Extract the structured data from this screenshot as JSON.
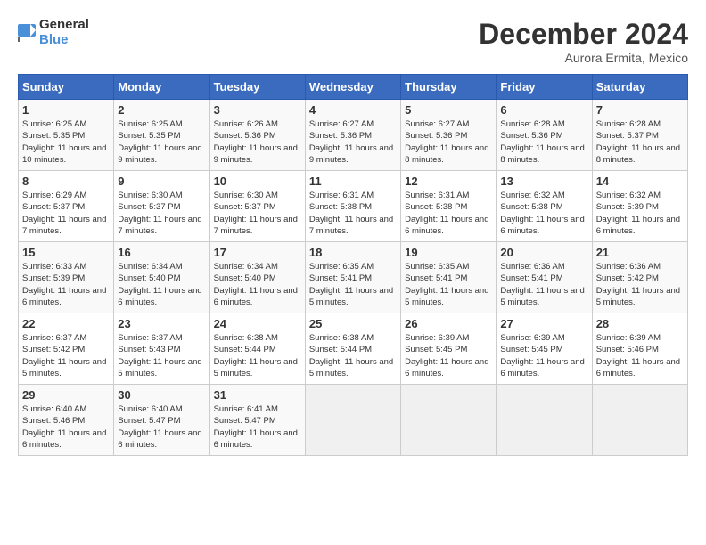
{
  "header": {
    "logo_line1": "General",
    "logo_line2": "Blue",
    "month": "December 2024",
    "location": "Aurora Ermita, Mexico"
  },
  "weekdays": [
    "Sunday",
    "Monday",
    "Tuesday",
    "Wednesday",
    "Thursday",
    "Friday",
    "Saturday"
  ],
  "weeks": [
    [
      {
        "day": "1",
        "sunrise": "6:25 AM",
        "sunset": "5:35 PM",
        "daylight": "11 hours and 10 minutes."
      },
      {
        "day": "2",
        "sunrise": "6:25 AM",
        "sunset": "5:35 PM",
        "daylight": "11 hours and 9 minutes."
      },
      {
        "day": "3",
        "sunrise": "6:26 AM",
        "sunset": "5:36 PM",
        "daylight": "11 hours and 9 minutes."
      },
      {
        "day": "4",
        "sunrise": "6:27 AM",
        "sunset": "5:36 PM",
        "daylight": "11 hours and 9 minutes."
      },
      {
        "day": "5",
        "sunrise": "6:27 AM",
        "sunset": "5:36 PM",
        "daylight": "11 hours and 8 minutes."
      },
      {
        "day": "6",
        "sunrise": "6:28 AM",
        "sunset": "5:36 PM",
        "daylight": "11 hours and 8 minutes."
      },
      {
        "day": "7",
        "sunrise": "6:28 AM",
        "sunset": "5:37 PM",
        "daylight": "11 hours and 8 minutes."
      }
    ],
    [
      {
        "day": "8",
        "sunrise": "6:29 AM",
        "sunset": "5:37 PM",
        "daylight": "11 hours and 7 minutes."
      },
      {
        "day": "9",
        "sunrise": "6:30 AM",
        "sunset": "5:37 PM",
        "daylight": "11 hours and 7 minutes."
      },
      {
        "day": "10",
        "sunrise": "6:30 AM",
        "sunset": "5:37 PM",
        "daylight": "11 hours and 7 minutes."
      },
      {
        "day": "11",
        "sunrise": "6:31 AM",
        "sunset": "5:38 PM",
        "daylight": "11 hours and 7 minutes."
      },
      {
        "day": "12",
        "sunrise": "6:31 AM",
        "sunset": "5:38 PM",
        "daylight": "11 hours and 6 minutes."
      },
      {
        "day": "13",
        "sunrise": "6:32 AM",
        "sunset": "5:38 PM",
        "daylight": "11 hours and 6 minutes."
      },
      {
        "day": "14",
        "sunrise": "6:32 AM",
        "sunset": "5:39 PM",
        "daylight": "11 hours and 6 minutes."
      }
    ],
    [
      {
        "day": "15",
        "sunrise": "6:33 AM",
        "sunset": "5:39 PM",
        "daylight": "11 hours and 6 minutes."
      },
      {
        "day": "16",
        "sunrise": "6:34 AM",
        "sunset": "5:40 PM",
        "daylight": "11 hours and 6 minutes."
      },
      {
        "day": "17",
        "sunrise": "6:34 AM",
        "sunset": "5:40 PM",
        "daylight": "11 hours and 6 minutes."
      },
      {
        "day": "18",
        "sunrise": "6:35 AM",
        "sunset": "5:41 PM",
        "daylight": "11 hours and 5 minutes."
      },
      {
        "day": "19",
        "sunrise": "6:35 AM",
        "sunset": "5:41 PM",
        "daylight": "11 hours and 5 minutes."
      },
      {
        "day": "20",
        "sunrise": "6:36 AM",
        "sunset": "5:41 PM",
        "daylight": "11 hours and 5 minutes."
      },
      {
        "day": "21",
        "sunrise": "6:36 AM",
        "sunset": "5:42 PM",
        "daylight": "11 hours and 5 minutes."
      }
    ],
    [
      {
        "day": "22",
        "sunrise": "6:37 AM",
        "sunset": "5:42 PM",
        "daylight": "11 hours and 5 minutes."
      },
      {
        "day": "23",
        "sunrise": "6:37 AM",
        "sunset": "5:43 PM",
        "daylight": "11 hours and 5 minutes."
      },
      {
        "day": "24",
        "sunrise": "6:38 AM",
        "sunset": "5:44 PM",
        "daylight": "11 hours and 5 minutes."
      },
      {
        "day": "25",
        "sunrise": "6:38 AM",
        "sunset": "5:44 PM",
        "daylight": "11 hours and 5 minutes."
      },
      {
        "day": "26",
        "sunrise": "6:39 AM",
        "sunset": "5:45 PM",
        "daylight": "11 hours and 6 minutes."
      },
      {
        "day": "27",
        "sunrise": "6:39 AM",
        "sunset": "5:45 PM",
        "daylight": "11 hours and 6 minutes."
      },
      {
        "day": "28",
        "sunrise": "6:39 AM",
        "sunset": "5:46 PM",
        "daylight": "11 hours and 6 minutes."
      }
    ],
    [
      {
        "day": "29",
        "sunrise": "6:40 AM",
        "sunset": "5:46 PM",
        "daylight": "11 hours and 6 minutes."
      },
      {
        "day": "30",
        "sunrise": "6:40 AM",
        "sunset": "5:47 PM",
        "daylight": "11 hours and 6 minutes."
      },
      {
        "day": "31",
        "sunrise": "6:41 AM",
        "sunset": "5:47 PM",
        "daylight": "11 hours and 6 minutes."
      },
      null,
      null,
      null,
      null
    ]
  ]
}
